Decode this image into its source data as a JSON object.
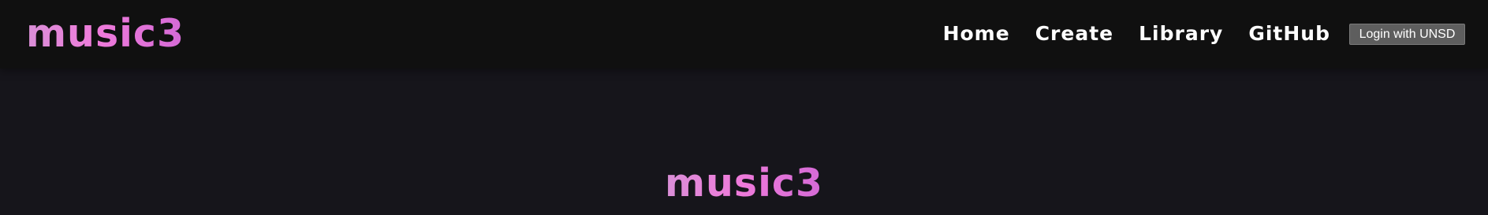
{
  "header": {
    "logo_text": "music3",
    "nav": {
      "home": "Home",
      "create": "Create",
      "library": "Library",
      "github": "GitHub"
    },
    "login_label": "Login with UNSD"
  },
  "main": {
    "title": "music3"
  },
  "colors": {
    "background": "#16151b",
    "navbar": "#101010",
    "logo_gradient_start": "#d98fd7",
    "logo_gradient_mid": "#ef7bdb",
    "logo_gradient_end": "#d46ad6",
    "login_button": "#5e5e5e"
  }
}
